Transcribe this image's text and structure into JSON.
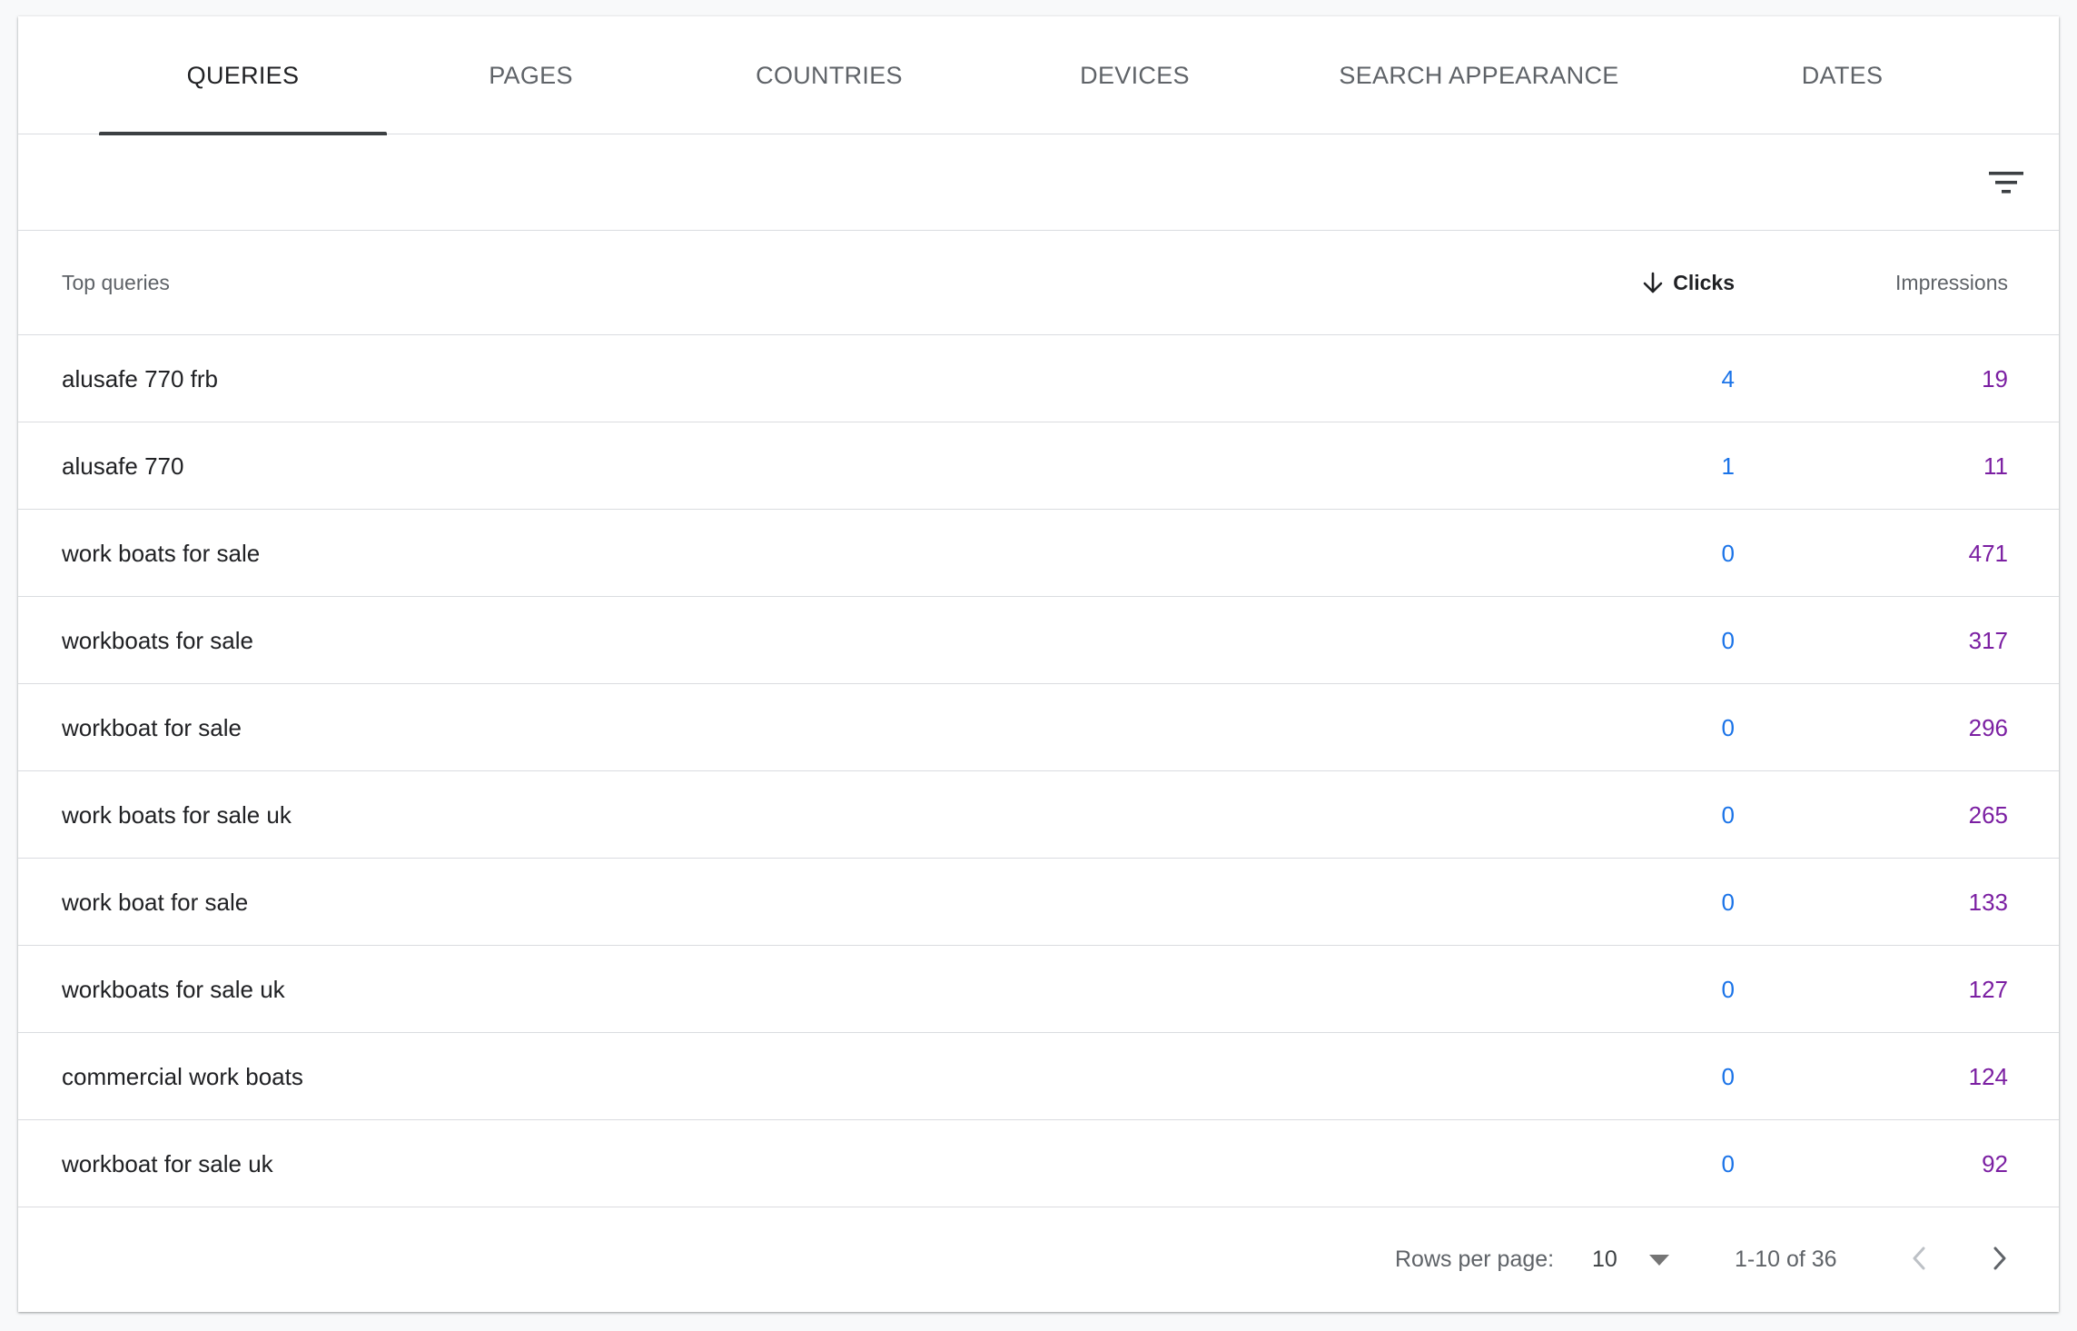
{
  "tabs": [
    {
      "label": "QUERIES",
      "active": true
    },
    {
      "label": "PAGES",
      "active": false
    },
    {
      "label": "COUNTRIES",
      "active": false
    },
    {
      "label": "DEVICES",
      "active": false
    },
    {
      "label": "SEARCH APPEARANCE",
      "active": false
    },
    {
      "label": "DATES",
      "active": false
    }
  ],
  "filter": {
    "icon": "filter-icon"
  },
  "table": {
    "header": {
      "query": "Top queries",
      "clicks": "Clicks",
      "impressions": "Impressions",
      "sort_icon": "arrow-down-icon"
    },
    "rows": [
      {
        "query": "alusafe 770 frb",
        "clicks": "4",
        "impressions": "19"
      },
      {
        "query": "alusafe 770",
        "clicks": "1",
        "impressions": "11"
      },
      {
        "query": "work boats for sale",
        "clicks": "0",
        "impressions": "471"
      },
      {
        "query": "workboats for sale",
        "clicks": "0",
        "impressions": "317"
      },
      {
        "query": "workboat for sale",
        "clicks": "0",
        "impressions": "296"
      },
      {
        "query": "work boats for sale uk",
        "clicks": "0",
        "impressions": "265"
      },
      {
        "query": "work boat for sale",
        "clicks": "0",
        "impressions": "133"
      },
      {
        "query": "workboats for sale uk",
        "clicks": "0",
        "impressions": "127"
      },
      {
        "query": "commercial work boats",
        "clicks": "0",
        "impressions": "124"
      },
      {
        "query": "workboat for sale uk",
        "clicks": "0",
        "impressions": "92"
      }
    ]
  },
  "footer": {
    "rows_per_page_label": "Rows per page:",
    "rows_per_page_value": "10",
    "range": "1-10 of 36",
    "prev_icon": "chevron-left-icon",
    "next_icon": "chevron-right-icon"
  },
  "colors": {
    "clicks": "#1a73e8",
    "impressions": "#7b1fa2",
    "tab_indicator": "#3c4043"
  }
}
